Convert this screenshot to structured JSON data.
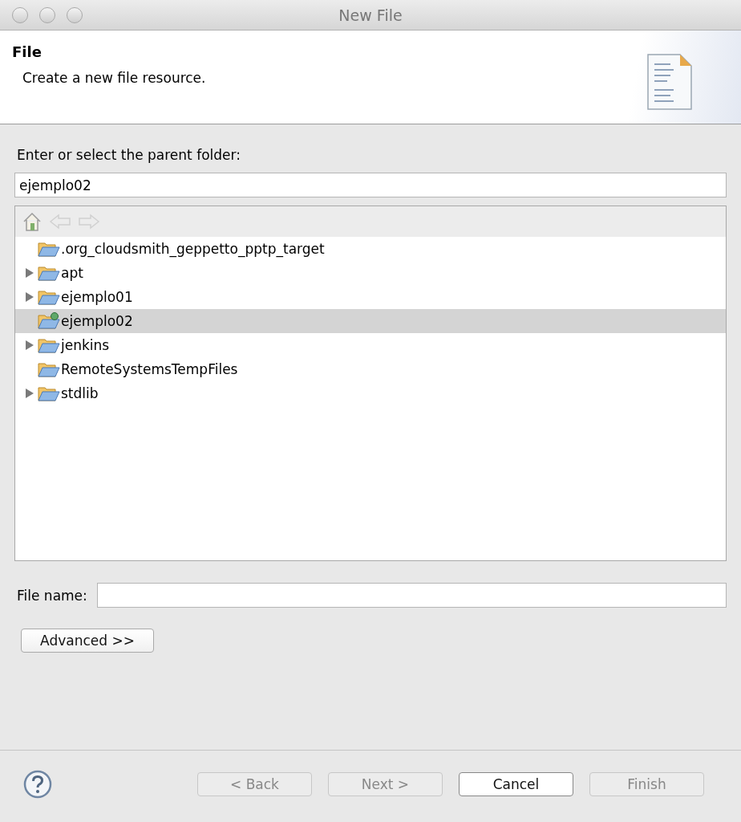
{
  "window": {
    "title": "New File"
  },
  "header": {
    "title": "File",
    "description": "Create a new file resource."
  },
  "parent_folder": {
    "label": "Enter or select the parent folder:",
    "value": "ejemplo02"
  },
  "tree": [
    {
      "label": ".org_cloudsmith_geppetto_pptp_target",
      "expandable": false,
      "selected": false,
      "decorated": false
    },
    {
      "label": "apt",
      "expandable": true,
      "selected": false,
      "decorated": false
    },
    {
      "label": "ejemplo01",
      "expandable": true,
      "selected": false,
      "decorated": false
    },
    {
      "label": "ejemplo02",
      "expandable": false,
      "selected": true,
      "decorated": true
    },
    {
      "label": "jenkins",
      "expandable": true,
      "selected": false,
      "decorated": false
    },
    {
      "label": "RemoteSystemsTempFiles",
      "expandable": false,
      "selected": false,
      "decorated": false
    },
    {
      "label": "stdlib",
      "expandable": true,
      "selected": false,
      "decorated": false
    }
  ],
  "file_name": {
    "label": "File name:"
  },
  "advanced_button": "Advanced >>",
  "buttons": [
    {
      "label": "< Back",
      "disabled": true,
      "default": false
    },
    {
      "label": "Next >",
      "disabled": true,
      "default": false
    },
    {
      "label": "Cancel",
      "disabled": false,
      "default": true
    },
    {
      "label": "Finish",
      "disabled": true,
      "default": false
    }
  ]
}
